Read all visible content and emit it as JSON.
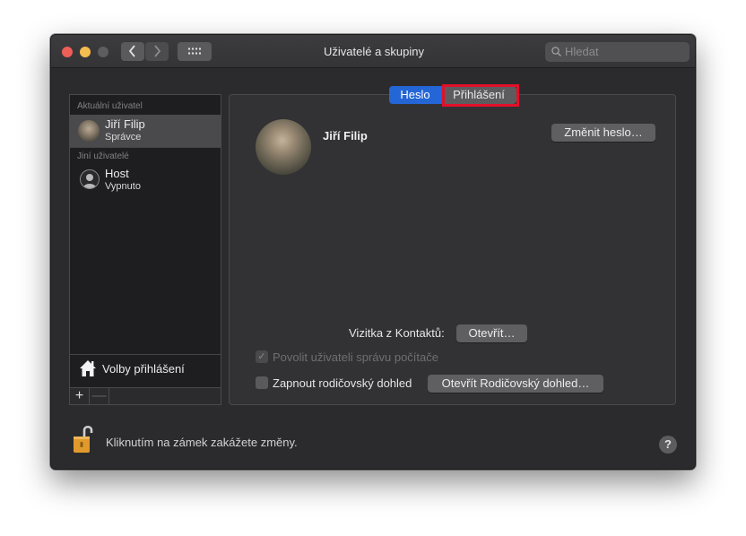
{
  "window": {
    "title": "Uživatelé a skupiny",
    "search_placeholder": "Hledat"
  },
  "toolbar": {
    "back_icon": "chevron-left-icon",
    "forward_icon": "chevron-right-icon",
    "grid_icon": "show-all-grid-icon"
  },
  "sidebar": {
    "current_heading": "Aktuální uživatel",
    "current_user": {
      "name": "Jiří Filip",
      "role": "Správce"
    },
    "other_heading": "Jiní uživatelé",
    "other_users": [
      {
        "name": "Host",
        "status": "Vypnuto"
      }
    ],
    "login_options_label": "Volby přihlášení",
    "add_label": "+",
    "remove_label": "—"
  },
  "tabs": {
    "items": [
      "Heslo",
      "Přihlášení"
    ],
    "selected": "Heslo",
    "highlighted": "Přihlášení",
    "highlight_color": "#e2102a"
  },
  "main": {
    "user_name": "Jiří Filip",
    "change_password_label": "Změnit heslo…",
    "contacts_card_label": "Vizitka z Kontaktů:",
    "open_label": "Otevřít…",
    "allow_admin_label": "Povolit uživateli správu počítače",
    "allow_admin_checked": true,
    "allow_admin_enabled": false,
    "parental_label": "Zapnout rodičovský dohled",
    "parental_checked": false,
    "open_parental_label": "Otevřít Rodičovský dohled…"
  },
  "footer": {
    "lock_text": "Kliknutím na zámek zakážete změny.",
    "help_label": "?"
  },
  "colors": {
    "accent": "#2466d6",
    "window_bg": "#2b2b2d",
    "close": "#ed5f57",
    "minimize": "#f5bd4f"
  }
}
